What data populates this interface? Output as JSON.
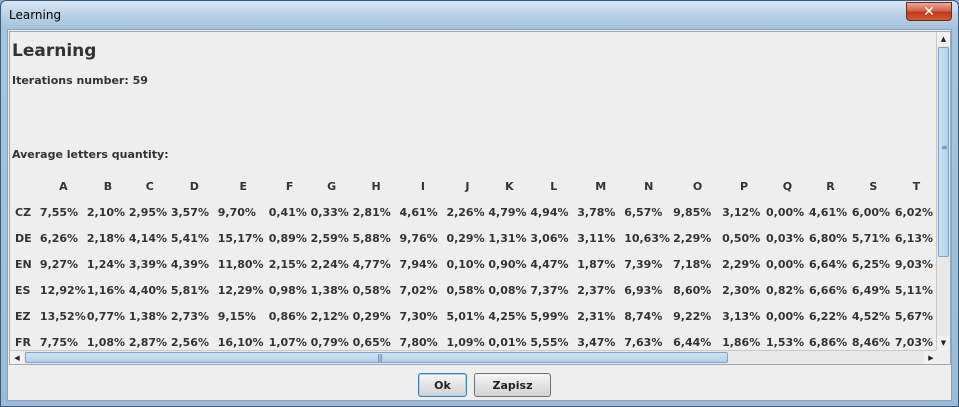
{
  "window": {
    "title": "Learning",
    "close_glyph": "✕"
  },
  "content": {
    "heading": "Learning",
    "iterations": "Iterations number: 59",
    "avg_title": "Average letters quantity:"
  },
  "table": {
    "letters": [
      "A",
      "B",
      "C",
      "D",
      "E",
      "F",
      "G",
      "H",
      "I",
      "J",
      "K",
      "L",
      "M",
      "N",
      "O",
      "P",
      "Q",
      "R",
      "S",
      "T"
    ],
    "rows": [
      {
        "lang": "CZ",
        "values": [
          "7,55%",
          "2,10%",
          "2,95%",
          "3,57%",
          "9,70%",
          "0,41%",
          "0,33%",
          "2,81%",
          "4,61%",
          "2,26%",
          "4,79%",
          "4,94%",
          "3,78%",
          "6,57%",
          "9,85%",
          "3,12%",
          "0,00%",
          "4,61%",
          "6,00%",
          "6,02%"
        ]
      },
      {
        "lang": "DE",
        "values": [
          "6,26%",
          "2,18%",
          "4,14%",
          "5,41%",
          "15,17%",
          "0,89%",
          "2,59%",
          "5,88%",
          "9,76%",
          "0,29%",
          "1,31%",
          "3,06%",
          "3,11%",
          "10,63%",
          "2,29%",
          "0,50%",
          "0,03%",
          "6,80%",
          "5,71%",
          "6,13%"
        ]
      },
      {
        "lang": "EN",
        "values": [
          "9,27%",
          "1,24%",
          "3,39%",
          "4,39%",
          "11,80%",
          "2,15%",
          "2,24%",
          "4,77%",
          "7,94%",
          "0,10%",
          "0,90%",
          "4,47%",
          "1,87%",
          "7,39%",
          "7,18%",
          "2,29%",
          "0,00%",
          "6,64%",
          "6,25%",
          "9,03%"
        ]
      },
      {
        "lang": "ES",
        "values": [
          "12,92%",
          "1,16%",
          "4,40%",
          "5,81%",
          "12,29%",
          "0,98%",
          "1,38%",
          "0,58%",
          "7,02%",
          "0,58%",
          "0,08%",
          "7,37%",
          "2,37%",
          "6,93%",
          "8,60%",
          "2,30%",
          "0,82%",
          "6,66%",
          "6,49%",
          "5,11%"
        ]
      },
      {
        "lang": "EZ",
        "values": [
          "13,52%",
          "0,77%",
          "1,38%",
          "2,73%",
          "9,15%",
          "0,86%",
          "2,12%",
          "0,29%",
          "7,30%",
          "5,01%",
          "4,25%",
          "5,99%",
          "2,31%",
          "8,74%",
          "9,22%",
          "3,13%",
          "0,00%",
          "6,22%",
          "4,52%",
          "5,67%"
        ]
      },
      {
        "lang": "FR",
        "values": [
          "7,75%",
          "1,08%",
          "2,87%",
          "2,56%",
          "16,10%",
          "1,07%",
          "0,79%",
          "0,65%",
          "7,80%",
          "1,09%",
          "0,01%",
          "5,55%",
          "3,47%",
          "7,63%",
          "6,44%",
          "1,86%",
          "1,53%",
          "6,86%",
          "8,46%",
          "7,03%"
        ]
      }
    ]
  },
  "scrollbars": {
    "up_glyph": "▲",
    "down_glyph": "▼",
    "left_glyph": "◀",
    "right_glyph": "▶",
    "v_grip": "≡",
    "h_grip": "|||"
  },
  "buttons": {
    "ok": "Ok",
    "save": "Zapisz"
  }
}
